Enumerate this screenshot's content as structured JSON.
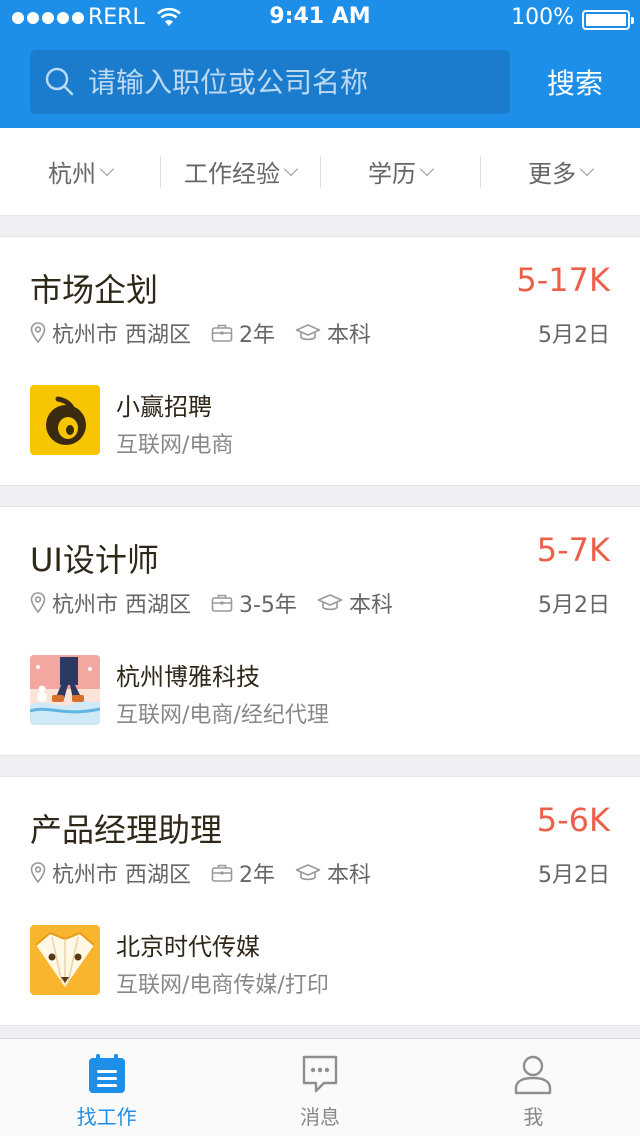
{
  "status_bar": {
    "carrier": "RERL",
    "time": "9:41 AM",
    "battery": "100%"
  },
  "search": {
    "placeholder": "请输入职位或公司名称",
    "button_label": "搜索"
  },
  "filters": [
    {
      "label": "杭州"
    },
    {
      "label": "工作经验"
    },
    {
      "label": "学历"
    },
    {
      "label": "更多"
    }
  ],
  "jobs": [
    {
      "title": "市场企划",
      "salary": "5-17K",
      "location": "杭州市 西湖区",
      "experience": "2年",
      "education": "本科",
      "date": "5月2日",
      "company": {
        "name": "小赢招聘",
        "industry": "互联网/电商",
        "logo_icon": "xiaoying-logo"
      }
    },
    {
      "title": "UI设计师",
      "salary": "5-7K",
      "location": "杭州市 西湖区",
      "experience": "3-5年",
      "education": "本科",
      "date": "5月2日",
      "company": {
        "name": "杭州博雅科技",
        "industry": "互联网/电商/经纪代理",
        "logo_icon": "winter-illustration-logo"
      }
    },
    {
      "title": "产品经理助理",
      "salary": "5-6K",
      "location": "杭州市 西湖区",
      "experience": "2年",
      "education": "本科",
      "date": "5月2日",
      "company": {
        "name": "北京时代传媒",
        "industry": "互联网/电商传媒/打印",
        "logo_icon": "pencil-fox-logo"
      }
    }
  ],
  "tabbar": [
    {
      "label": "找工作",
      "icon": "calendar-icon",
      "active": true
    },
    {
      "label": "消息",
      "icon": "chat-icon",
      "active": false
    },
    {
      "label": "我",
      "icon": "user-icon",
      "active": false
    }
  ],
  "colors": {
    "brand": "#1e8fe8",
    "salary": "#ec6049",
    "search_bg": "#1b7bcc"
  }
}
